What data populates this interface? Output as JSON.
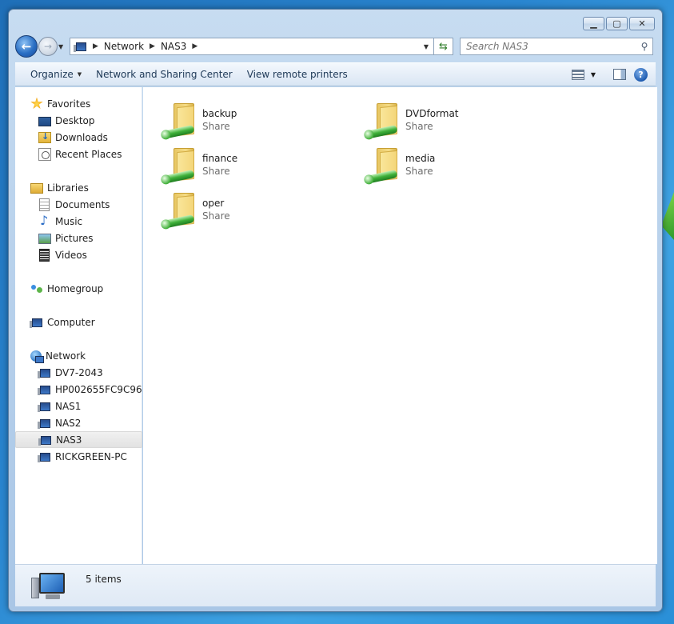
{
  "window": {
    "caption_buttons": {
      "minimize": "▁",
      "maximize": "▢",
      "close": "✕"
    }
  },
  "address_bar": {
    "breadcrumbs": [
      "Network",
      "NAS3"
    ],
    "search_placeholder": "Search NAS3"
  },
  "command_bar": {
    "organize": "Organize",
    "network_sharing_center": "Network and Sharing Center",
    "view_remote_printers": "View remote printers"
  },
  "nav_pane": {
    "favorites": {
      "label": "Favorites",
      "items": [
        {
          "label": "Desktop",
          "icon": "desktop-icon"
        },
        {
          "label": "Downloads",
          "icon": "downloads-icon"
        },
        {
          "label": "Recent Places",
          "icon": "recent-places-icon"
        }
      ]
    },
    "libraries": {
      "label": "Libraries",
      "items": [
        {
          "label": "Documents",
          "icon": "documents-icon"
        },
        {
          "label": "Music",
          "icon": "music-icon"
        },
        {
          "label": "Pictures",
          "icon": "pictures-icon"
        },
        {
          "label": "Videos",
          "icon": "videos-icon"
        }
      ]
    },
    "homegroup": {
      "label": "Homegroup"
    },
    "computer": {
      "label": "Computer"
    },
    "network": {
      "label": "Network",
      "items": [
        {
          "label": "DV7-2043"
        },
        {
          "label": "HP002655FC9C96"
        },
        {
          "label": "NAS1"
        },
        {
          "label": "NAS2"
        },
        {
          "label": "NAS3",
          "selected": true
        },
        {
          "label": "RICKGREEN-PC"
        }
      ]
    }
  },
  "shares": [
    {
      "name": "backup",
      "type": "Share"
    },
    {
      "name": "DVDformat",
      "type": "Share"
    },
    {
      "name": "finance",
      "type": "Share"
    },
    {
      "name": "media",
      "type": "Share"
    },
    {
      "name": "oper",
      "type": "Share"
    }
  ],
  "details_pane": {
    "item_count": "5 items"
  }
}
